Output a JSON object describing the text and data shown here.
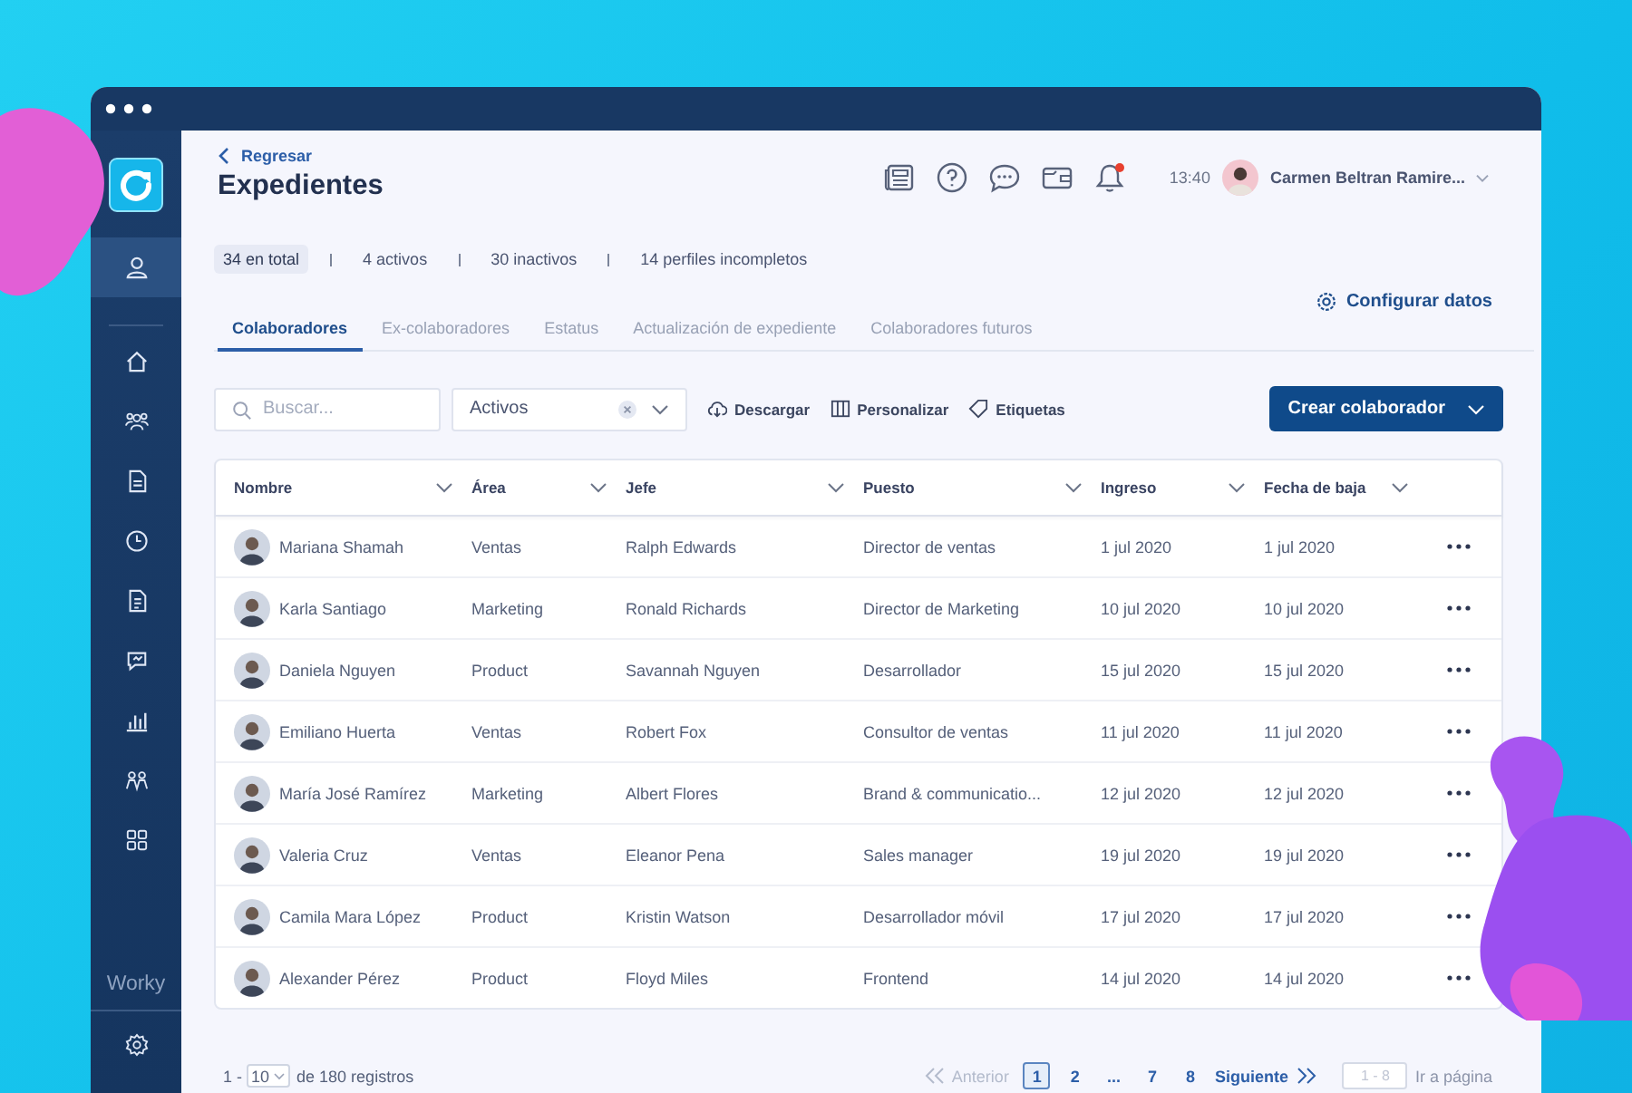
{
  "sidebar": {
    "items": [
      {
        "kind": "user",
        "selected": true
      },
      {
        "kind": "home",
        "selected": false
      },
      {
        "kind": "team",
        "selected": false
      },
      {
        "kind": "document",
        "selected": false
      },
      {
        "kind": "clock",
        "selected": false
      },
      {
        "kind": "file",
        "selected": false
      },
      {
        "kind": "feedback",
        "selected": false
      },
      {
        "kind": "chart",
        "selected": false
      },
      {
        "kind": "people",
        "selected": false
      },
      {
        "kind": "grid",
        "selected": false
      }
    ],
    "brand": "Worky"
  },
  "header": {
    "back_link": "Regresar",
    "title": "Expedientes",
    "icons": [
      {
        "kind": "news",
        "badge": false
      },
      {
        "kind": "help",
        "badge": false
      },
      {
        "kind": "chat",
        "badge": false
      },
      {
        "kind": "wallet",
        "badge": false
      },
      {
        "kind": "bell",
        "badge": true
      }
    ],
    "time": "13:40",
    "user_name": "Carmen Beltran Ramire..."
  },
  "stats": [
    {
      "label": "34 en total",
      "selected": true
    },
    {
      "label": "4 activos",
      "selected": false
    },
    {
      "label": "30 inactivos",
      "selected": false
    },
    {
      "label": "14 perfiles incompletos",
      "selected": false
    }
  ],
  "configure_link": "Configurar datos",
  "tabs": [
    {
      "label": "Colaboradores",
      "selected": true
    },
    {
      "label": "Ex-colaboradores",
      "selected": false
    },
    {
      "label": "Estatus",
      "selected": false
    },
    {
      "label": "Actualización de expediente",
      "selected": false
    },
    {
      "label": "Colaboradores futuros",
      "selected": false
    }
  ],
  "toolbar": {
    "search": {
      "placeholder": "Buscar..."
    },
    "filter": {
      "value": "Activos"
    },
    "actions": [
      {
        "kind": "download",
        "label": "Descargar"
      },
      {
        "kind": "columns",
        "label": "Personalizar"
      },
      {
        "kind": "tag",
        "label": "Etiquetas"
      }
    ],
    "create_button": "Crear colaborador"
  },
  "table": {
    "columns": [
      "Nombre",
      "Área",
      "Jefe",
      "Puesto",
      "Ingreso",
      "Fecha de baja"
    ],
    "rows": [
      {
        "name": "Mariana Shamah",
        "area": "Ventas",
        "boss": "Ralph Edwards",
        "position": "Director de ventas",
        "start": "1 jul 2020",
        "end": "1 jul 2020"
      },
      {
        "name": "Karla Santiago",
        "area": "Marketing",
        "boss": "Ronald Richards",
        "position": "Director de Marketing",
        "start": "10 jul 2020",
        "end": "10 jul 2020"
      },
      {
        "name": "Daniela Nguyen",
        "area": "Product",
        "boss": "Savannah Nguyen",
        "position": "Desarrollador",
        "start": "15 jul 2020",
        "end": "15 jul 2020"
      },
      {
        "name": "Emiliano Huerta",
        "area": "Ventas",
        "boss": "Robert Fox",
        "position": "Consultor de ventas",
        "start": "11 jul 2020",
        "end": "11 jul 2020"
      },
      {
        "name": "María José Ramírez",
        "area": "Marketing",
        "boss": "Albert Flores",
        "position": "Brand & communicatio...",
        "start": "12 jul 2020",
        "end": "12 jul 2020"
      },
      {
        "name": "Valeria Cruz",
        "area": "Ventas",
        "boss": "Eleanor Pena",
        "position": "Sales manager",
        "start": "19 jul 2020",
        "end": "19 jul 2020"
      },
      {
        "name": "Camila Mara López",
        "area": "Product",
        "boss": "Kristin Watson",
        "position": "Desarrollador móvil",
        "start": "17 jul 2020",
        "end": "17 jul 2020"
      },
      {
        "name": "Alexander Pérez",
        "area": "Product",
        "boss": "Floyd Miles",
        "position": "Frontend",
        "start": "14 jul 2020",
        "end": "14 jul 2020"
      }
    ]
  },
  "pagination": {
    "range_start": "1 -",
    "page_size": "10",
    "total": "de 180 registros",
    "previous": "Anterior",
    "previous_disabled": true,
    "pages": [
      {
        "label": "1",
        "selected": true
      },
      {
        "label": "2",
        "selected": false
      },
      {
        "label": "...",
        "selected": false
      },
      {
        "label": "7",
        "selected": false
      },
      {
        "label": "8",
        "selected": false
      }
    ],
    "next": "Siguiente",
    "goto": {
      "placeholder": "1 - 8"
    },
    "goto_label": "Ir a página"
  }
}
